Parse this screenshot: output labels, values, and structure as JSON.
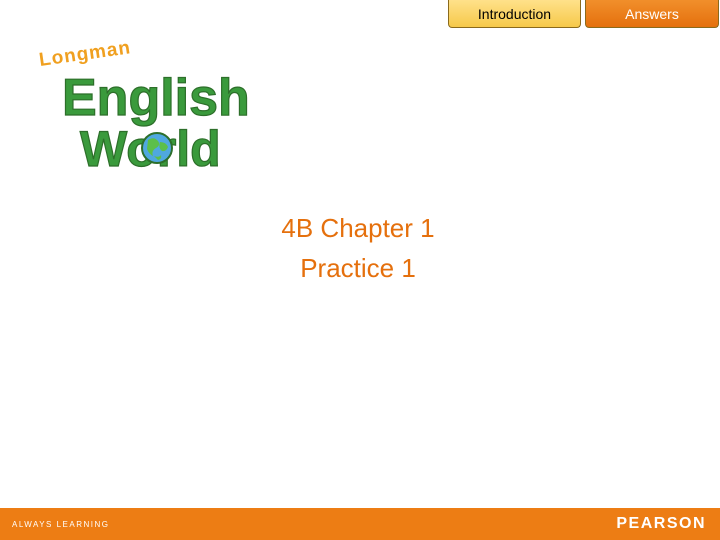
{
  "nav": {
    "introduction_label": "Introduction",
    "answers_label": "Answers"
  },
  "logo": {
    "brand_small": "Longman",
    "word_1": "English",
    "word_2": "World",
    "colors": {
      "green": "#3a9a3c",
      "dark_green": "#2d6f2a",
      "globe_blue": "#4fa8df"
    }
  },
  "content": {
    "title_line_1": "4B Chapter 1",
    "title_line_2": "Practice 1"
  },
  "footer": {
    "tagline": "ALWAYS LEARNING",
    "brand": "PEARSON"
  },
  "colors": {
    "accent_orange": "#e5700d",
    "footer_orange": "#ed7d14",
    "tab_yellow": "#f6c94a"
  }
}
